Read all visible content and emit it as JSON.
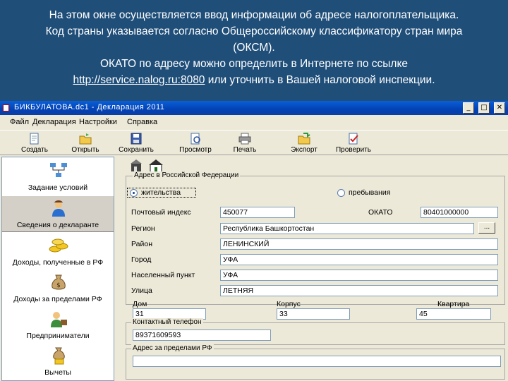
{
  "caption": {
    "line1": "На этом окне осуществляется ввод информации об адресе налогоплательщика.",
    "line2": "Код страны указывается согласно Общероссийскому классификатору стран мира",
    "line3": "(ОКСМ).",
    "line4": "ОКАТО по адресу можно определить в Интернете по ссылке",
    "link": "http://service.nalog.ru:8080",
    "line5_rest": " или уточнить в Вашей налоговой инспекции."
  },
  "window": {
    "title": "БИКБУЛАТОВА.dc1 - Декларация 2011",
    "minimize": "_",
    "maximize": "□",
    "close": "✕"
  },
  "menu": [
    "Файл",
    "Декларация",
    "Настройки",
    "Справка"
  ],
  "toolbar": [
    {
      "label": "Создать",
      "icon": "new-document-icon"
    },
    {
      "label": "Открыть",
      "icon": "open-folder-icon"
    },
    {
      "label": "Сохранить",
      "icon": "save-disk-icon"
    },
    {
      "label": "Просмотр",
      "icon": "preview-icon"
    },
    {
      "label": "Печать",
      "icon": "printer-icon"
    },
    {
      "label": "Экспорт",
      "icon": "export-icon"
    },
    {
      "label": "Проверить",
      "icon": "check-icon"
    }
  ],
  "sidebar": [
    {
      "label": "Задание условий",
      "icon": "conditions-icon"
    },
    {
      "label": "Сведения о декларанте",
      "icon": "declarant-icon"
    },
    {
      "label": "Доходы, полученные в РФ",
      "icon": "coins-icon"
    },
    {
      "label": "Доходы за пределами РФ",
      "icon": "money-bag-icon"
    },
    {
      "label": "Предприниматели",
      "icon": "entrepreneur-icon"
    },
    {
      "label": "Вычеты",
      "icon": "deductions-icon"
    }
  ],
  "address_ru": {
    "group_title": "Адрес в Российской Федерации",
    "radio_residence": "жительства",
    "radio_stay": "пребывания",
    "postal_label": "Почтовый индекс",
    "postal_value": "450077",
    "okato_label": "ОКАТО",
    "okato_value": "80401000000",
    "region_label": "Регион",
    "region_value": "Республика Башкортостан",
    "region_button": "...",
    "district_label": "Район",
    "district_value": "ЛЕНИНСКИЙ",
    "city_label": "Город",
    "city_value": "УФА",
    "locality_label": "Населенный пункт",
    "locality_value": "УФА",
    "street_label": "Улица",
    "street_value": "ЛЕТНЯЯ",
    "house_label": "Дом",
    "house_value": "31",
    "building_label": "Корпус",
    "building_value": "33",
    "apartment_label": "Квартира",
    "apartment_value": "45"
  },
  "contact": {
    "group_title": "Контактный телефон",
    "phone": "89371609593"
  },
  "abroad": {
    "group_title": "Адрес за пределами РФ",
    "value": ""
  }
}
